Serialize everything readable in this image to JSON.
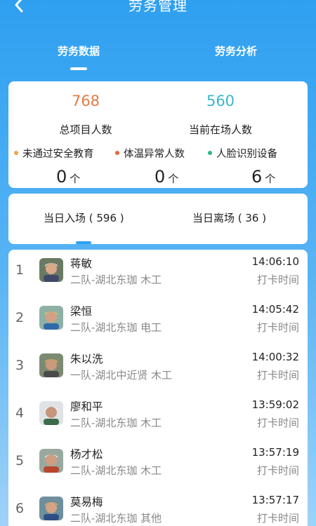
{
  "header": {
    "title": "劳务管理",
    "back_icon": "chevron-left-icon"
  },
  "tabs": [
    {
      "label": "劳务数据",
      "active": true
    },
    {
      "label": "劳务分析",
      "active": false
    }
  ],
  "stats": {
    "total_value": "768",
    "total_label": "总项目人数",
    "onsite_value": "560",
    "onsite_label": "当前在场人数",
    "metrics": [
      {
        "label": "未通过安全教育",
        "value": "0",
        "unit": "个",
        "dot_color": "#f1a14a"
      },
      {
        "label": "体温异常人数",
        "value": "0",
        "unit": "个",
        "dot_color": "#e4683b"
      },
      {
        "label": "人脸识别设备",
        "value": "6",
        "unit": "个",
        "dot_color": "#2bb58f"
      }
    ]
  },
  "entry_tabs": {
    "entry": "当日入场 ( 596 )",
    "exit": "当日离场 ( 36 )"
  },
  "records": [
    {
      "index": "1",
      "name": "蒋敏",
      "team": "二队-湖北东珈 木工",
      "time": "14:06:10",
      "time_label": "打卡时间"
    },
    {
      "index": "2",
      "name": "梁恒",
      "team": "二队-湖北东珈 电工",
      "time": "14:05:42",
      "time_label": "打卡时间"
    },
    {
      "index": "3",
      "name": "朱以洗",
      "team": "一队-湖北中近贤 木工",
      "time": "14:00:32",
      "time_label": "打卡时间"
    },
    {
      "index": "4",
      "name": "廖和平",
      "team": "二队-湖北东珈 木工",
      "time": "13:59:02",
      "time_label": "打卡时间"
    },
    {
      "index": "5",
      "name": "杨才松",
      "team": "二队-湖北东珈 木工",
      "time": "13:57:19",
      "time_label": "打卡时间"
    },
    {
      "index": "6",
      "name": "莫易梅",
      "team": "二队-湖北东珈 其他",
      "time": "13:57:17",
      "time_label": "打卡时间"
    }
  ],
  "colors": {
    "accent": "#2f9ff0",
    "orange": "#e77a45",
    "teal": "#3ab8c6"
  }
}
